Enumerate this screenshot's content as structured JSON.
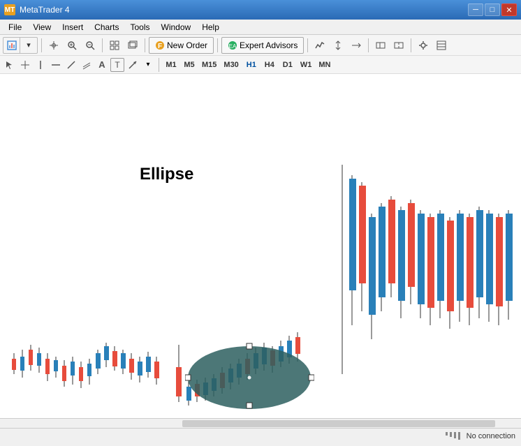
{
  "titleBar": {
    "icon": "MT",
    "title": "MetaTrader 4",
    "controls": {
      "minimize": "─",
      "maximize": "□",
      "close": "✕"
    }
  },
  "menuBar": {
    "items": [
      "File",
      "View",
      "Insert",
      "Charts",
      "Tools",
      "Window",
      "Help"
    ]
  },
  "toolbar1": {
    "newOrder": "New Order",
    "expertAdvisors": "Expert Advisors"
  },
  "toolbar2": {
    "timeframes": [
      "M1",
      "M5",
      "M15",
      "M30",
      "H1",
      "H4",
      "D1",
      "W1",
      "MN"
    ]
  },
  "chart": {
    "ellipseLabel": "Ellipse"
  },
  "statusBar": {
    "connection": "No connection"
  }
}
